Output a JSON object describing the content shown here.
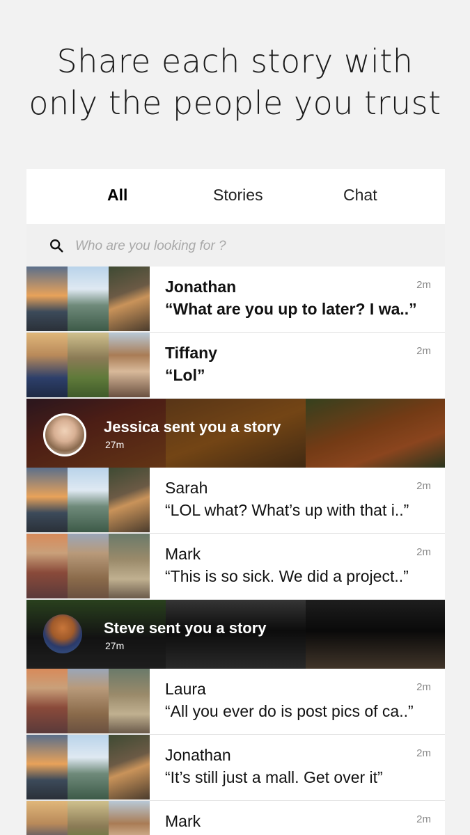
{
  "headline": {
    "line1": "Share each story with",
    "line2": "only the people you trust"
  },
  "tabs": [
    {
      "label": "All",
      "active": true
    },
    {
      "label": "Stories",
      "active": false
    },
    {
      "label": "Chat",
      "active": false
    }
  ],
  "search": {
    "placeholder": "Who are you looking for ?",
    "icon": "search-icon"
  },
  "conversations": [
    {
      "type": "chat",
      "name": "Jonathan",
      "message": "“What are you up to later? I wa..”",
      "time": "2m",
      "unread": true
    },
    {
      "type": "chat",
      "name": "Tiffany",
      "message": "“Lol”",
      "time": "2m",
      "unread": true
    },
    {
      "type": "story",
      "title": "Jessica sent you a story",
      "time": "27m"
    },
    {
      "type": "chat",
      "name": "Sarah",
      "message": "“LOL what? What’s up with that i..”",
      "time": "2m",
      "unread": false
    },
    {
      "type": "chat",
      "name": "Mark",
      "message": "“This is so sick. We did a project..”",
      "time": "2m",
      "unread": false
    },
    {
      "type": "story",
      "title": "Steve sent you a story",
      "time": "27m"
    },
    {
      "type": "chat",
      "name": "Laura",
      "message": "“All you ever do is post pics of ca..”",
      "time": "2m",
      "unread": false
    },
    {
      "type": "chat",
      "name": "Jonathan",
      "message": "“It’s still just a mall. Get over it”",
      "time": "2m",
      "unread": false
    },
    {
      "type": "chat",
      "name": "Mark",
      "message": "",
      "time": "2m",
      "unread": false
    }
  ]
}
